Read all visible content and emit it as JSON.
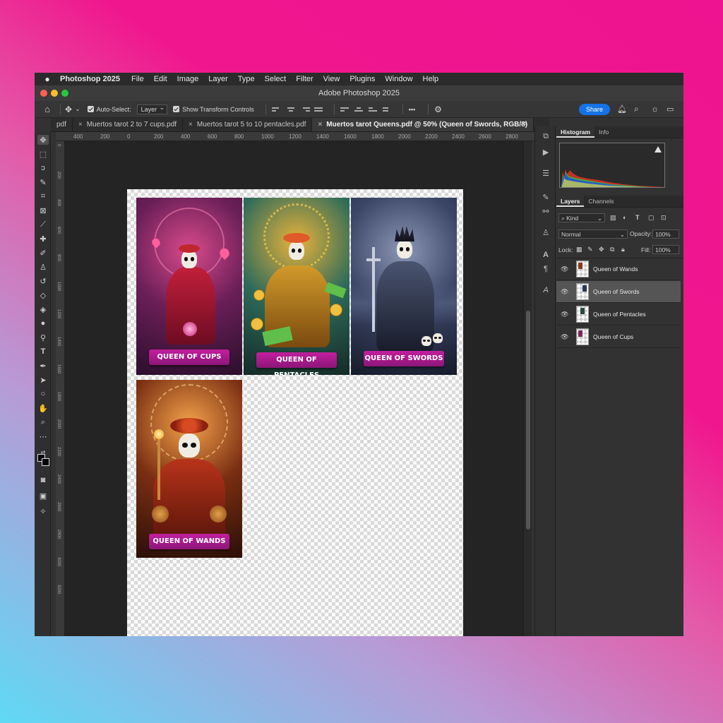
{
  "menubar": {
    "app": "Photoshop 2025",
    "items": [
      "File",
      "Edit",
      "Image",
      "Layer",
      "Type",
      "Select",
      "Filter",
      "View",
      "Plugins",
      "Window",
      "Help"
    ]
  },
  "window": {
    "title": "Adobe Photoshop 2025",
    "traffic_colors": [
      "#ff5f57",
      "#febc2e",
      "#28c840"
    ]
  },
  "options_bar": {
    "auto_select_label": "Auto-Select:",
    "auto_select_value": "Layer",
    "show_transform_label": "Show Transform Controls",
    "more_label": "•••",
    "share_label": "Share"
  },
  "tabs": [
    {
      "label": "pdf",
      "active": false
    },
    {
      "label": "Muertos tarot 2 to 7 cups.pdf",
      "active": false
    },
    {
      "label": "Muertos  tarot 5 to 10 pentacles.pdf",
      "active": false
    },
    {
      "label": "Muertos tarot Queens.pdf @ 50% (Queen of Swords, RGB/8)",
      "active": true
    }
  ],
  "tabs_overflow": "»",
  "ruler": {
    "h_ticks": [
      "400",
      "200",
      "0",
      "200",
      "400",
      "600",
      "800",
      "1000",
      "1200",
      "1400",
      "1600",
      "1800",
      "2000",
      "2200",
      "2400",
      "2600",
      "2800"
    ],
    "v_ticks": [
      "0",
      "2 0 0",
      "4 0 0",
      "6 0 0",
      "8 0 0",
      "1 0 0 0",
      "1 2 0 0",
      "1 4 0 0",
      "1 6 0 0",
      "1 8 0 0",
      "2 0 0 0",
      "2 2 0 0",
      "2 4 0 0",
      "2 6 0 0",
      "2 8 0 0",
      "3 0 0 0",
      "3 2 0 0"
    ]
  },
  "cards": [
    {
      "name": "queen-of-cups",
      "banner": "QUEEN OF CUPS",
      "bg": "#5a1f4f",
      "accent": "#e6508f"
    },
    {
      "name": "queen-of-pentacles",
      "banner": "QUEEN OF PENTACLES",
      "bg": "#2c4a3c",
      "accent": "#d9a532"
    },
    {
      "name": "queen-of-swords",
      "banner": "QUEEN OF SWORDS",
      "bg": "#2d3550",
      "accent": "#aab6cf"
    },
    {
      "name": "queen-of-wands",
      "banner": "QUEEN OF WANDS",
      "bg": "#3a1a0e",
      "accent": "#e07a2a"
    }
  ],
  "panels": {
    "top_tabs": [
      "Histogram",
      "Info"
    ],
    "layers_tabs": [
      "Layers",
      "Channels"
    ],
    "kind_label": "Kind",
    "blend_mode": "Normal",
    "opacity_label": "Opacity:",
    "opacity_value": "100%",
    "lock_label": "Lock:",
    "fill_label": "Fill:",
    "fill_value": "100%",
    "layers": [
      {
        "name": "Queen of Wands",
        "selected": false,
        "thumb": "#8a3a1a"
      },
      {
        "name": "Queen of Swords",
        "selected": true,
        "thumb": "#2d3550"
      },
      {
        "name": "Queen of Pentacles",
        "selected": false,
        "thumb": "#2c4a3c"
      },
      {
        "name": "Queen of Cups",
        "selected": false,
        "thumb": "#7a2a5a"
      }
    ]
  },
  "colors": {
    "accent_blue": "#1473e6",
    "banner_magenta": "#c21f9e"
  }
}
